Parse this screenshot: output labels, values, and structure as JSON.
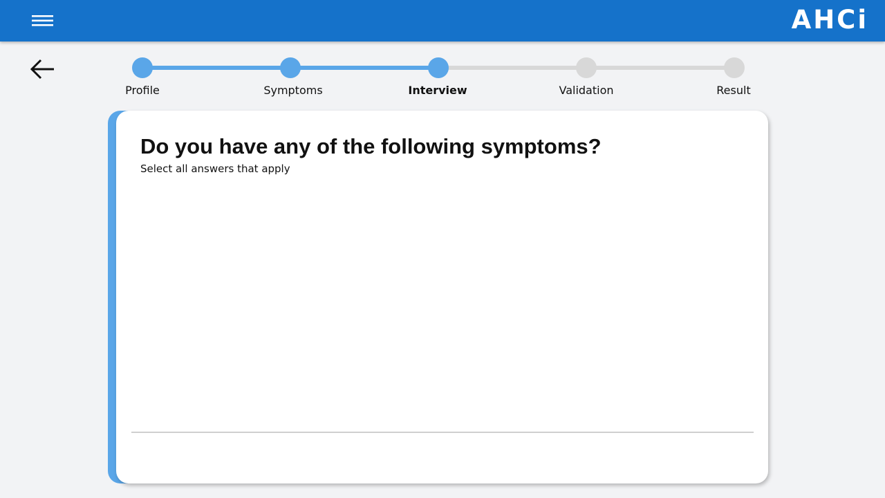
{
  "header": {
    "logo_text": "AHCi",
    "menu_icon": "hamburger-menu-icon",
    "background_color": "#1572ca"
  },
  "navigation": {
    "back_icon": "arrow-left-icon"
  },
  "stepper": {
    "active_color": "#5aa6e8",
    "inactive_color": "#d8d8d8",
    "current_step": 3,
    "steps": [
      {
        "label": "Profile",
        "state": "completed"
      },
      {
        "label": "Symptoms",
        "state": "completed"
      },
      {
        "label": "Interview",
        "state": "current"
      },
      {
        "label": "Validation",
        "state": "upcoming"
      },
      {
        "label": "Result",
        "state": "upcoming"
      }
    ]
  },
  "question": {
    "title": "Do you have any of the following symptoms?",
    "subtitle": "Select all answers that apply"
  }
}
